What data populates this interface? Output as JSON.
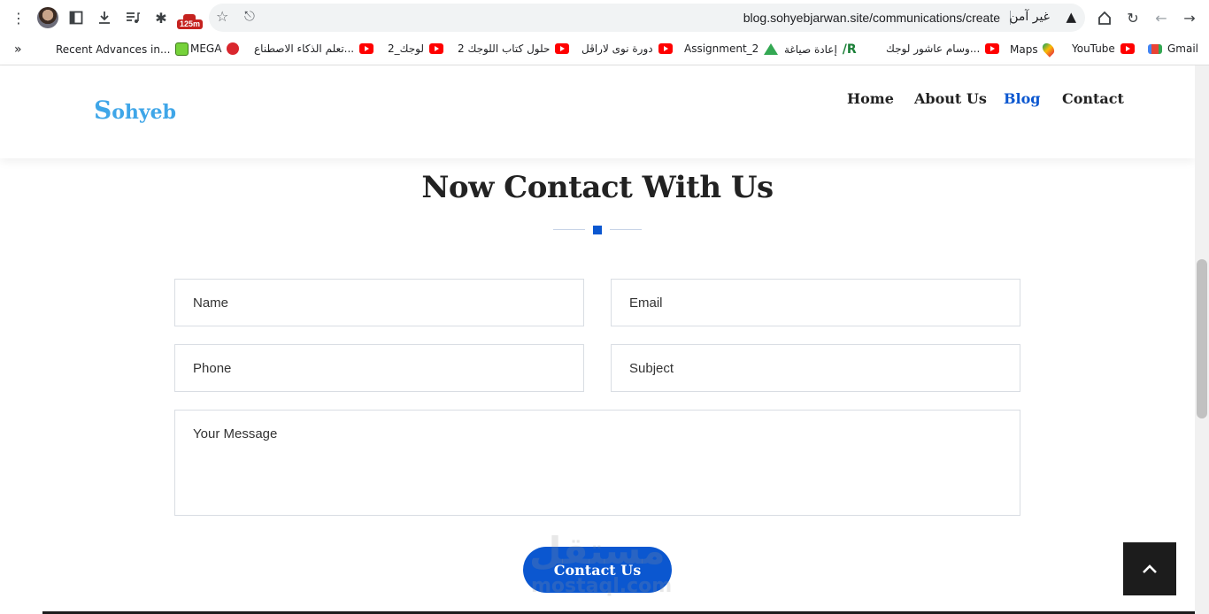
{
  "browser": {
    "url": "blog.sohyebjarwan.site/communications/create",
    "security_label": "غير آمن",
    "extension_badge": "125m",
    "bookmarks": [
      {
        "label": "Gmail",
        "icon": "gmail-icon"
      },
      {
        "label": "YouTube",
        "icon": "youtube-icon"
      },
      {
        "label": "Maps",
        "icon": "maps-icon"
      },
      {
        "label": "وسام عاشور لوجك...",
        "icon": "youtube-icon"
      },
      {
        "label": "إعادة صياغة",
        "icon": "pr-icon"
      },
      {
        "label": "Assignment_2",
        "icon": "drive-icon"
      },
      {
        "label": "دورة نوى لاراڤل",
        "icon": "youtube-icon"
      },
      {
        "label": "حلول كتاب اللوجك 2",
        "icon": "youtube-icon"
      },
      {
        "label": "لوجك_2",
        "icon": "youtube-icon"
      },
      {
        "label": "تعلم الذكاء الاصطناع...",
        "icon": "youtube-icon"
      },
      {
        "label": "MEGA",
        "icon": "mega-icon"
      },
      {
        "label": "Recent Advances in...",
        "icon": "smiley-icon"
      }
    ],
    "more_bookmarks": "»"
  },
  "site": {
    "logo_initial": "S",
    "logo_rest": "ohyeb",
    "nav": [
      {
        "label": "Home",
        "active": false
      },
      {
        "label": "About Us",
        "active": false
      },
      {
        "label": "Blog",
        "active": true
      },
      {
        "label": "Contact",
        "active": false
      }
    ]
  },
  "contact": {
    "title": "Now Contact With Us",
    "name_placeholder": "Name",
    "email_placeholder": "Email",
    "phone_placeholder": "Phone",
    "subject_placeholder": "Subject",
    "message_placeholder": "Your Message",
    "submit_label": "Contact Us"
  },
  "watermark": {
    "arabic": "مستقل",
    "latin": "mostaql.com"
  },
  "colors": {
    "accent": "#0b57d0",
    "logo": "#3fa6e8",
    "to_top_bg": "#1c1c1c"
  }
}
